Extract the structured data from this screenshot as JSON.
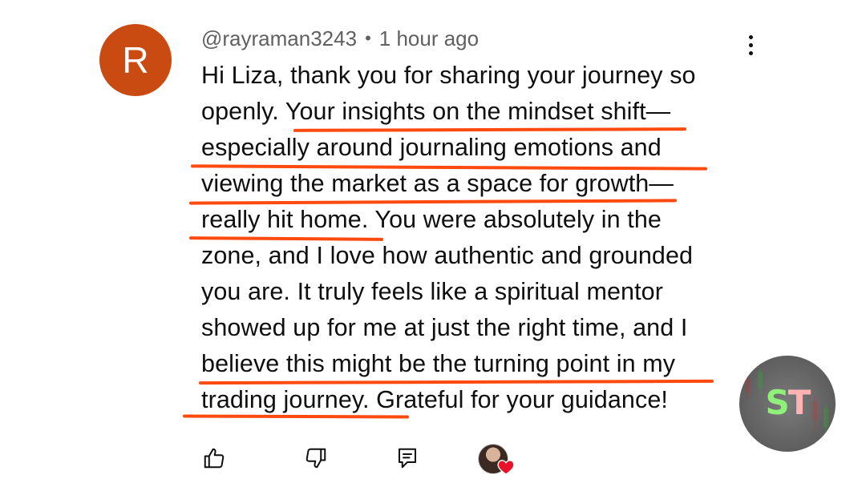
{
  "comment": {
    "author_initial": "R",
    "author_handle": "@rayraman3243",
    "separator": "•",
    "timestamp": "1 hour ago",
    "lines": [
      "Hi Liza, thank you for sharing your journey so",
      "openly. Your insights on the mindset shift—",
      "especially around journaling emotions and",
      "viewing the market as a space for growth—",
      "really hit home. You were absolutely in the",
      "zone, and I love how authentic and grounded",
      "you are. It truly feels like a spiritual mentor",
      "showed up for me at just the right time, and I",
      "believe this might be the turning point in my",
      "trading journey. Grateful for your guidance!"
    ],
    "avatar_color": "#c94b12",
    "underline_color": "#ff4a0f"
  },
  "actions": {
    "like_icon": "thumbs-up-icon",
    "dislike_icon": "thumbs-down-icon",
    "reply_icon": "reply-comment-icon",
    "creator_heart_icon": "heart-icon"
  },
  "watermark": {
    "letter_1": "S",
    "letter_2": "T"
  }
}
